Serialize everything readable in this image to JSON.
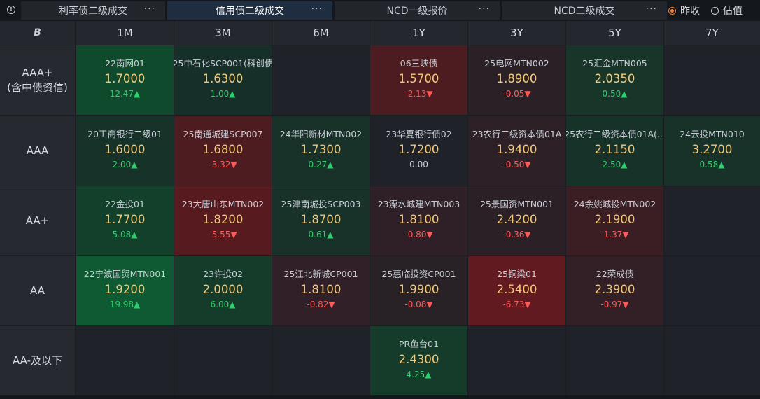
{
  "tabs": [
    {
      "label": "利率债二级成交",
      "more": "···"
    },
    {
      "label": "信用债二级成交",
      "more": "···"
    },
    {
      "label": "NCD一级报价",
      "more": "···"
    },
    {
      "label": "NCD二级成交",
      "more": "···"
    }
  ],
  "radios": [
    {
      "label": "昨收",
      "checked": true
    },
    {
      "label": "估值",
      "checked": false
    }
  ],
  "corner_logo": "B",
  "columns": [
    "1M",
    "3M",
    "6M",
    "1Y",
    "3Y",
    "5Y",
    "7Y"
  ],
  "rows": [
    {
      "label": "AAA+\n(含中债资信)",
      "cells": [
        {
          "name": "22南网01",
          "yield": "1.7000",
          "change": "12.47▲",
          "dir": "up",
          "bg": "#0f4a2c"
        },
        {
          "name": "25中石化SCP001(科创债",
          "yield": "1.6300",
          "change": "1.00▲",
          "dir": "up",
          "bg": "#163029"
        },
        null,
        {
          "name": "06三峡债",
          "yield": "1.5700",
          "change": "-2.13▼",
          "dir": "down",
          "bg": "#4d1c20"
        },
        {
          "name": "25电网MTN002",
          "yield": "1.8900",
          "change": "-0.05▼",
          "dir": "down",
          "bg": "#2b2026"
        },
        {
          "name": "25汇金MTN005",
          "yield": "2.0350",
          "change": "0.50▲",
          "dir": "up",
          "bg": "#18352a"
        },
        null
      ]
    },
    {
      "label": "AAA",
      "cells": [
        {
          "name": "20工商银行二级01",
          "yield": "1.6000",
          "change": "2.00▲",
          "dir": "up",
          "bg": "#173329"
        },
        {
          "name": "25南通城建SCP007",
          "yield": "1.6800",
          "change": "-3.32▼",
          "dir": "down",
          "bg": "#4d1c20"
        },
        {
          "name": "24华阳新材MTN002",
          "yield": "1.7300",
          "change": "0.27▲",
          "dir": "up",
          "bg": "#18322a"
        },
        {
          "name": "23华夏银行债02",
          "yield": "1.7200",
          "change": "0.00",
          "dir": "flat",
          "bg": "#1f2229"
        },
        {
          "name": "23农行二级资本债01A",
          "yield": "1.9400",
          "change": "-0.50▼",
          "dir": "down",
          "bg": "#2d2026"
        },
        {
          "name": "25农行二级资本债01A(...",
          "yield": "2.1150",
          "change": "2.50▲",
          "dir": "up",
          "bg": "#173329"
        },
        {
          "name": "24云投MTN010",
          "yield": "3.2700",
          "change": "0.58▲",
          "dir": "up",
          "bg": "#18322a"
        }
      ]
    },
    {
      "label": "AA+",
      "cells": [
        {
          "name": "22金投01",
          "yield": "1.7700",
          "change": "5.08▲",
          "dir": "up",
          "bg": "#12402b"
        },
        {
          "name": "23大唐山东MTN002",
          "yield": "1.8200",
          "change": "-5.55▼",
          "dir": "down",
          "bg": "#571a1f"
        },
        {
          "name": "25津南城投SCP003",
          "yield": "1.8700",
          "change": "0.61▲",
          "dir": "up",
          "bg": "#18322a"
        },
        {
          "name": "23溧水城建MTN003",
          "yield": "1.8100",
          "change": "-0.80▼",
          "dir": "down",
          "bg": "#2f2027"
        },
        {
          "name": "25景国资MTN001",
          "yield": "2.4200",
          "change": "-0.36▼",
          "dir": "down",
          "bg": "#2b2026"
        },
        {
          "name": "24余姚城投MTN002",
          "yield": "2.1900",
          "change": "-1.37▼",
          "dir": "down",
          "bg": "#3a1e23"
        },
        null
      ]
    },
    {
      "label": "AA",
      "cells": [
        {
          "name": "22宁波国贸MTN001",
          "yield": "1.9200",
          "change": "19.98▲",
          "dir": "up",
          "bg": "#0f5a32"
        },
        {
          "name": "23许投02",
          "yield": "2.0000",
          "change": "6.00▲",
          "dir": "up",
          "bg": "#153b2a"
        },
        {
          "name": "25江北新城CP001",
          "yield": "1.8100",
          "change": "-0.82▼",
          "dir": "down",
          "bg": "#312027"
        },
        {
          "name": "25惠临投资CP001",
          "yield": "1.9900",
          "change": "-0.08▼",
          "dir": "down",
          "bg": "#282126"
        },
        {
          "name": "25铜梁01",
          "yield": "2.5400",
          "change": "-6.73▼",
          "dir": "down",
          "bg": "#611a20"
        },
        {
          "name": "22荣成债",
          "yield": "2.3900",
          "change": "-0.97▼",
          "dir": "down",
          "bg": "#332026"
        },
        null
      ]
    },
    {
      "label": "AA-及以下",
      "cells": [
        null,
        null,
        null,
        {
          "name": "PR鱼台01",
          "yield": "2.4300",
          "change": "4.25▲",
          "dir": "up",
          "bg": "#153b2a"
        },
        null,
        null,
        null
      ]
    }
  ]
}
